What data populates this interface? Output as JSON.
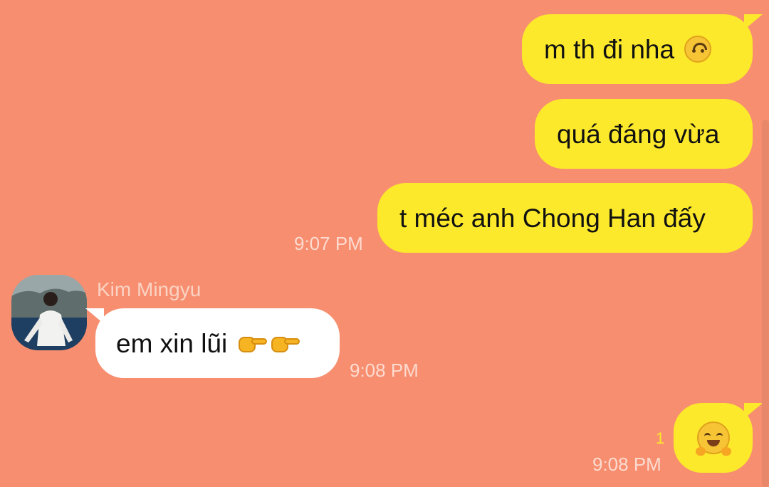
{
  "messages": [
    {
      "id": "m1",
      "direction": "outgoing",
      "text": "m th đi nha",
      "emoji": "upside-down-face"
    },
    {
      "id": "m2",
      "direction": "outgoing",
      "text": "quá đáng vừa"
    },
    {
      "id": "m3",
      "direction": "outgoing",
      "text": "t méc anh Chong Han đấy",
      "time": "9:07 PM"
    },
    {
      "id": "m4",
      "direction": "incoming",
      "sender": "Kim Mingyu",
      "text": "em xin lũi",
      "emoji": "pointing-hands",
      "time": "9:08 PM"
    },
    {
      "id": "m5",
      "direction": "outgoing",
      "emoji": "hugging-face",
      "unread": "1",
      "time": "9:08 PM"
    }
  ],
  "colors": {
    "background": "#f78e6f",
    "outgoing_bubble": "#fde92c",
    "incoming_bubble": "#ffffff",
    "timestamp": "#fde0d6",
    "unread_count": "#fde92c"
  }
}
